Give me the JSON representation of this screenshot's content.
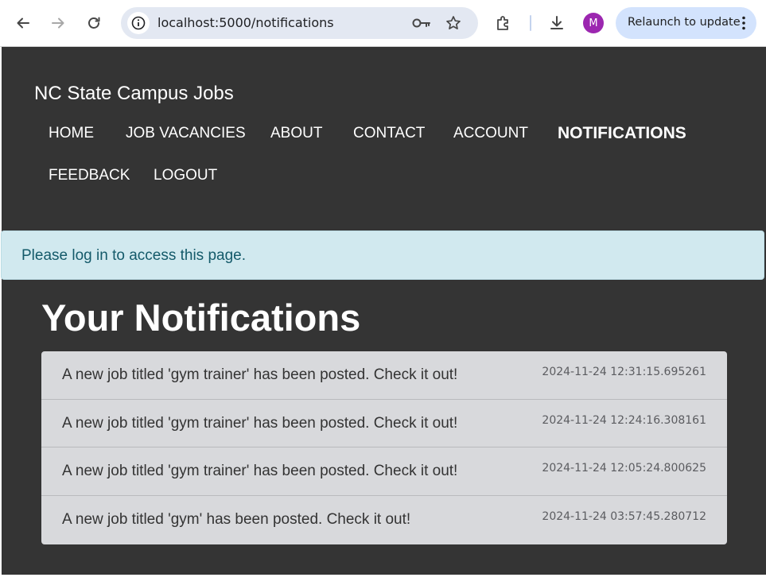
{
  "browser": {
    "url": "localhost:5000/notifications",
    "relaunch_label": "Relaunch to update",
    "profile_initial": "M",
    "profile_color": "#9c27b0",
    "icons": [
      "back-arrow-icon",
      "forward-arrow-icon",
      "reload-icon",
      "site-info-icon",
      "password-key-icon",
      "bookmark-star-icon",
      "extensions-puzzle-icon",
      "download-icon",
      "more-vert-icon"
    ]
  },
  "site": {
    "brand": "NC State Campus Jobs",
    "nav": [
      {
        "label": "HOME"
      },
      {
        "label": "JOB VACANCIES"
      },
      {
        "label": "ABOUT"
      },
      {
        "label": "CONTACT"
      },
      {
        "label": "ACCOUNT"
      },
      {
        "label": "NOTIFICATIONS",
        "active": true
      },
      {
        "label": "FEEDBACK"
      },
      {
        "label": "LOGOUT"
      }
    ]
  },
  "alert": {
    "message": "Please log in to access this page."
  },
  "main": {
    "heading": "Your Notifications",
    "notifications": [
      {
        "text": "A new job titled 'gym trainer' has been posted. Check it out!",
        "timestamp": "2024-11-24 12:31:15.695261"
      },
      {
        "text": "A new job titled 'gym trainer' has been posted. Check it out!",
        "timestamp": "2024-11-24 12:24:16.308161"
      },
      {
        "text": "A new job titled 'gym trainer' has been posted. Check it out!",
        "timestamp": "2024-11-24 12:05:24.800625"
      },
      {
        "text": "A new job titled 'gym' has been posted. Check it out!",
        "timestamp": "2024-11-24 03:57:45.280712"
      }
    ]
  },
  "colors": {
    "page_background": "#343434",
    "alert_background": "#d1e9ef",
    "alert_text": "#145a6a",
    "list_background": "#d8d9dc"
  }
}
